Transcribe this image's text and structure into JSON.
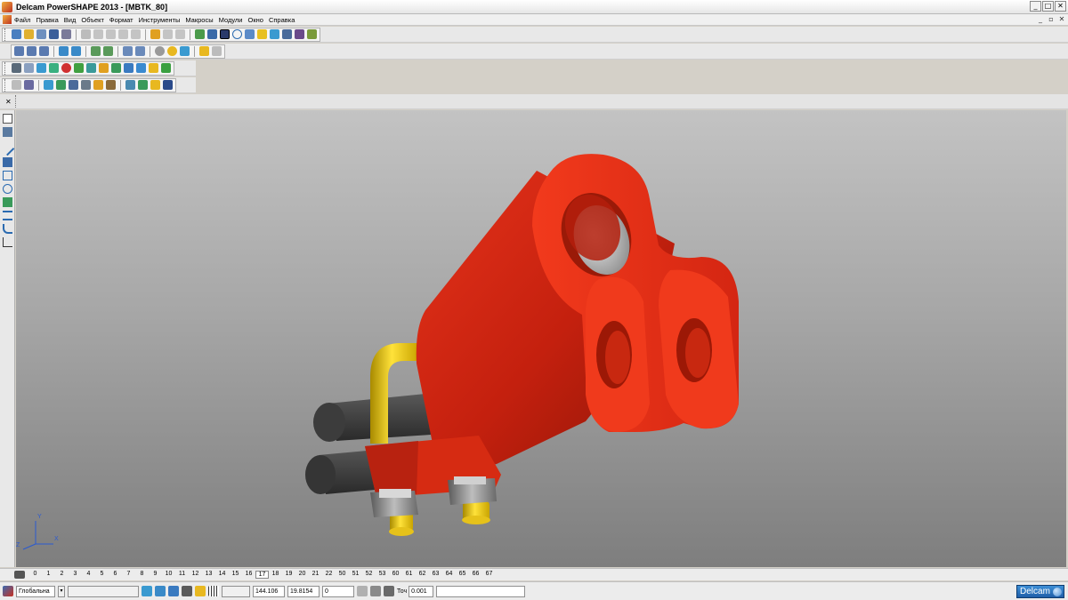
{
  "window": {
    "title": "Delcam PowerSHAPE 2013 - [MBTK_80]",
    "minimize": "_",
    "maximize": "□",
    "close": "✕"
  },
  "menu": {
    "items": [
      "Файл",
      "Правка",
      "Вид",
      "Объект",
      "Формат",
      "Инструменты",
      "Макросы",
      "Модули",
      "Окно",
      "Справка"
    ],
    "mdi_minimize": "_",
    "mdi_restore": "▫",
    "mdi_close": "✕"
  },
  "toolbars": {
    "accent_blue": "#2f6fb8",
    "accent_green": "#3c9a3c",
    "accent_yellow": "#e8c020",
    "accent_red": "#c83020"
  },
  "viewport": {
    "background_top": "#c3c3c3",
    "background_bottom": "#7e7e7e",
    "axis_x": "X",
    "axis_y": "Y",
    "axis_z": "Z"
  },
  "levels": {
    "items": [
      "0",
      "1",
      "2",
      "3",
      "4",
      "5",
      "6",
      "7",
      "8",
      "9",
      "10",
      "11",
      "12",
      "13",
      "14",
      "15",
      "16",
      "17",
      "18",
      "19",
      "20",
      "21",
      "22",
      "50",
      "51",
      "52",
      "53",
      "60",
      "61",
      "62",
      "63",
      "64",
      "65",
      "66",
      "67"
    ],
    "active": "17"
  },
  "status": {
    "workplane": "Глобальна",
    "x_value": "144.106",
    "y_value": "19.8154",
    "z_value": "0",
    "tolerance_label": "Точ",
    "tolerance_value": "0.001",
    "brand": "Delcam"
  }
}
